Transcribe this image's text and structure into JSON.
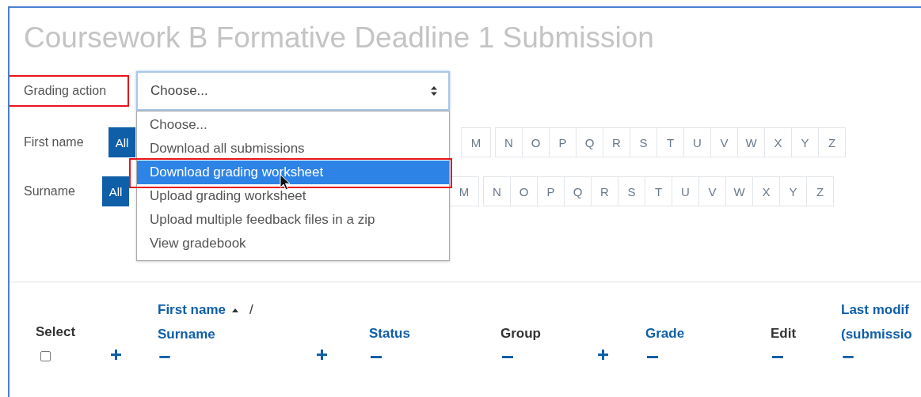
{
  "title": "Coursework B Formative Deadline 1 Submission",
  "grading_action": {
    "label": "Grading action",
    "annotated": true,
    "value": "Choose...",
    "expanded": true,
    "options": [
      {
        "label": "Choose...",
        "highlighted": false,
        "annotated": false
      },
      {
        "label": "Download all submissions",
        "highlighted": false,
        "annotated": false
      },
      {
        "label": "Download grading worksheet",
        "highlighted": true,
        "annotated": true
      },
      {
        "label": "Upload grading worksheet",
        "highlighted": false,
        "annotated": false
      },
      {
        "label": "Upload multiple feedback files in a zip",
        "highlighted": false,
        "annotated": false
      },
      {
        "label": "View gradebook",
        "highlighted": false,
        "annotated": false
      }
    ]
  },
  "filters": [
    {
      "label": "First name",
      "all": "All",
      "letters": [
        "M",
        "N",
        "O",
        "P",
        "Q",
        "R",
        "S",
        "T",
        "U",
        "V",
        "W",
        "X",
        "Y",
        "Z"
      ]
    },
    {
      "label": "Surname",
      "all": "All",
      "letters": [
        "M",
        "N",
        "O",
        "P",
        "Q",
        "R",
        "S",
        "T",
        "U",
        "V",
        "W",
        "X",
        "Y",
        "Z"
      ]
    }
  ],
  "table": {
    "columns": [
      {
        "kind": "select",
        "lines": [
          "Select"
        ],
        "link": false,
        "checked": false
      },
      {
        "kind": "expand"
      },
      {
        "kind": "heading",
        "lines": [
          "First name",
          "Surname"
        ],
        "separator": "/",
        "sorted": true,
        "link": true,
        "collapse": true
      },
      {
        "kind": "expand"
      },
      {
        "kind": "heading",
        "lines": [
          "Status"
        ],
        "link": true,
        "collapse": true
      },
      {
        "kind": "heading",
        "lines": [
          "Group"
        ],
        "link": false,
        "collapse": true
      },
      {
        "kind": "expand"
      },
      {
        "kind": "heading",
        "lines": [
          "Grade"
        ],
        "link": true,
        "collapse": true
      },
      {
        "kind": "heading",
        "lines": [
          "Edit"
        ],
        "link": false,
        "collapse": true
      },
      {
        "kind": "heading",
        "lines": [
          "Last modif",
          "(submissio"
        ],
        "link": true,
        "collapse": true
      }
    ]
  }
}
